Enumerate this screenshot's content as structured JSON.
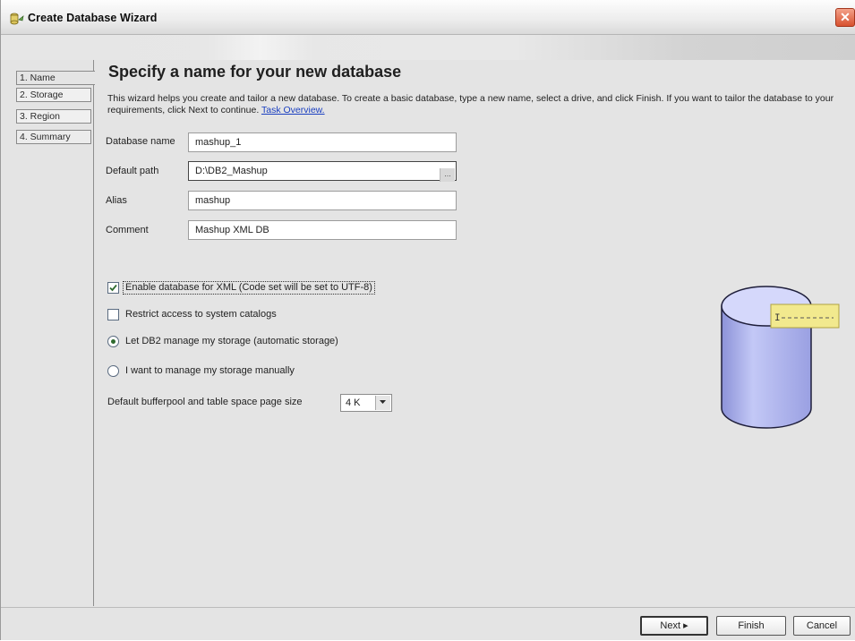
{
  "window": {
    "title": "Create Database Wizard",
    "close_label": "✕"
  },
  "steps": [
    {
      "label": "1. Name",
      "active": true
    },
    {
      "label": "2. Storage"
    },
    {
      "label": "3. Region"
    },
    {
      "label": "4. Summary"
    }
  ],
  "page": {
    "heading": "Specify a name for your new database",
    "description": "This wizard helps you create and tailor a new database. To create a basic database, type a new name, select a drive, and click Finish. If you want to tailor the database to your requirements, click Next to continue.",
    "link_text": "Task Overview."
  },
  "fields": {
    "db_name": {
      "label": "Database name",
      "value": "mashup_1"
    },
    "default_path": {
      "label": "Default path",
      "value": "D:\\DB2_Mashup",
      "browse_label": "..."
    },
    "alias": {
      "label": "Alias",
      "value": "mashup"
    },
    "comment": {
      "label": "Comment",
      "value": "Mashup XML DB"
    }
  },
  "options": {
    "enable_xml": {
      "label": "Enable database for XML (Code set will be set to UTF-8)",
      "checked": true
    },
    "restrict_catalogs": {
      "label": "Restrict access to system catalogs",
      "checked": false
    },
    "auto_storage": {
      "label": "Let DB2 manage my storage (automatic storage)",
      "selected": true
    },
    "manual_storage": {
      "label": "I want to manage my storage manually",
      "selected": false
    }
  },
  "page_size": {
    "label": "Default bufferpool and table space page size",
    "value": "4 K"
  },
  "buttons": {
    "next": "Next ▸",
    "finish": "Finish",
    "cancel": "Cancel"
  },
  "colors": {
    "cylinder": "#aab0ee",
    "tag": "#f2e98e",
    "link": "#1a3fc0"
  }
}
